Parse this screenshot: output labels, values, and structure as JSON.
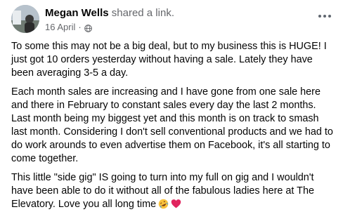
{
  "post": {
    "author": "Megan Wells",
    "action": "shared a link.",
    "date": "16 April",
    "separator": "·",
    "audience_icon": "globe-icon",
    "more_icon": "more-options-icon",
    "paragraphs": [
      "To some this may not be a big deal, but to my business this is HUGE! I just got 10 orders yesterday without having a sale. Lately they have been averaging 3-5 a day.",
      "Each month sales are increasing and I have gone from one sale here and there in February to constant sales every day the last 2 months. Last month being my biggest yet and this month is on track to smash last month. Considering I don't sell conventional products and we had to do work arounds to even advertise them on Facebook, it's all starting to come together.",
      "This little \"side gig\" IS going to turn into my full on gig and I wouldn't have been able to do it without all of the fabulous ladies here at The Elevatory. Love you all long time"
    ],
    "emojis": [
      "rolling-on-floor-laughing-emoji",
      "red-heart-emoji"
    ]
  },
  "colors": {
    "text": "#050505",
    "secondary": "#65676b",
    "heart": "#e0245e"
  }
}
